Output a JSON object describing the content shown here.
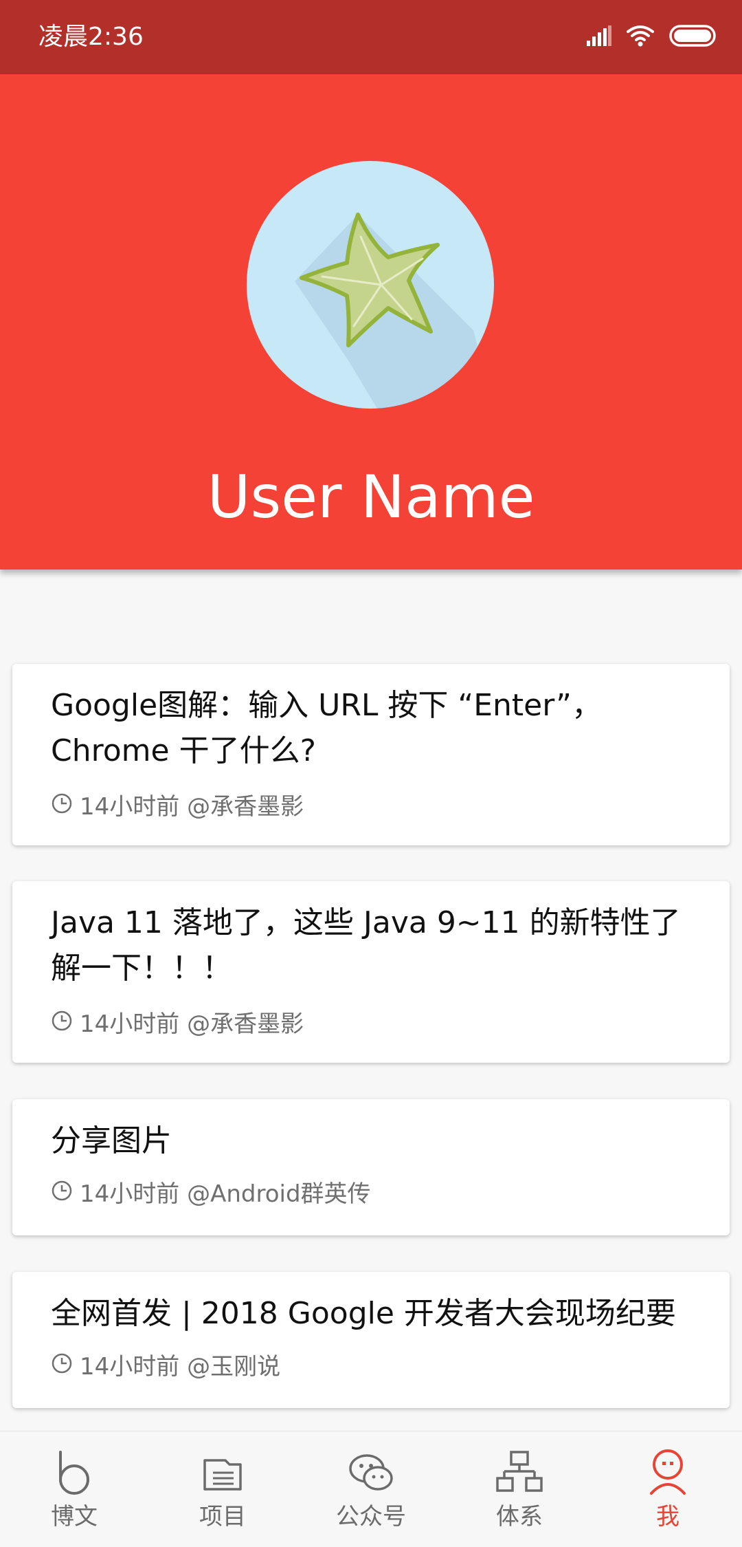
{
  "status_bar": {
    "time": "凌晨2:36",
    "background": "#b3302a",
    "icons": [
      "signal-icon",
      "wifi-icon",
      "battery-icon"
    ]
  },
  "header": {
    "background": "#f44336",
    "user_name": "User Name",
    "avatar_icon": "starfruit-avatar-icon"
  },
  "articles": [
    {
      "title": "Google图解：输入 URL 按下 “Enter”，Chrome 干了什么?",
      "meta": "14小时前 @承香墨影"
    },
    {
      "title": "Java 11 落地了，这些 Java 9~11 的新特性了解一下！！！",
      "meta": "14小时前 @承香墨影"
    },
    {
      "title": "分享图片",
      "meta": "14小时前 @Android群英传"
    },
    {
      "title": "全网首发 | 2018 Google 开发者大会现场纪要",
      "meta": "14小时前 @玉刚说"
    }
  ],
  "bottom_nav": {
    "active_color": "#e64435",
    "inactive_color": "#6b6b6b",
    "items": [
      {
        "label": "博文",
        "icon": "blog-icon"
      },
      {
        "label": "项目",
        "icon": "project-icon"
      },
      {
        "label": "公众号",
        "icon": "wechat-icon"
      },
      {
        "label": "体系",
        "icon": "hierarchy-icon"
      },
      {
        "label": "我",
        "icon": "profile-icon"
      }
    ]
  }
}
